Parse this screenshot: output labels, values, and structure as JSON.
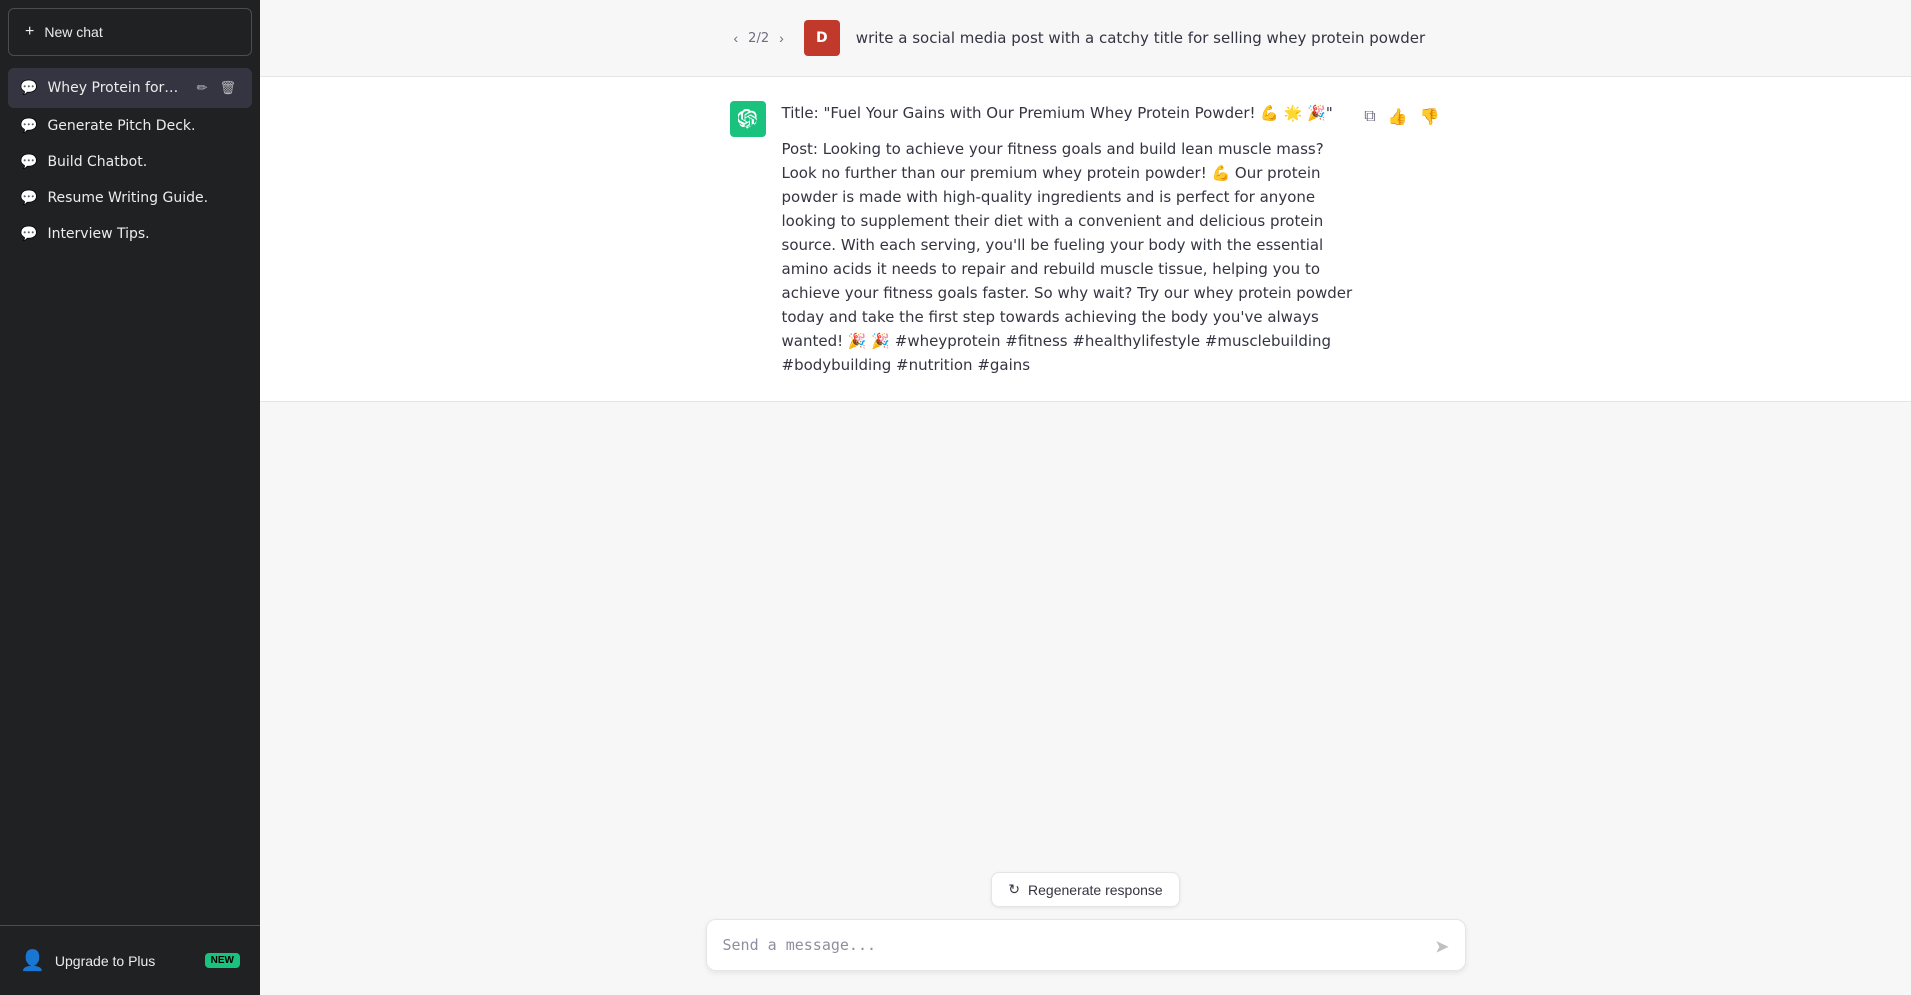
{
  "sidebar": {
    "new_chat_label": "New chat",
    "items": [
      {
        "id": "whey-protein",
        "label": "Whey Protein for Gains.",
        "active": true
      },
      {
        "id": "generate-pitch-deck",
        "label": "Generate Pitch Deck.",
        "active": false
      },
      {
        "id": "build-chatbot",
        "label": "Build Chatbot.",
        "active": false
      },
      {
        "id": "resume-writing-guide",
        "label": "Resume Writing Guide.",
        "active": false
      },
      {
        "id": "interview-tips",
        "label": "Interview Tips.",
        "active": false
      }
    ],
    "footer": {
      "upgrade_label": "Upgrade to Plus",
      "badge": "NEW"
    }
  },
  "chat": {
    "navigation": {
      "current": 2,
      "total": 2
    },
    "user_message": "write a social media post with a catchy title for selling whey protein powder",
    "user_avatar": "D",
    "ai_response_title": "Title: \"Fuel Your Gains with Our Premium Whey Protein Powder! 💪 🌟 🎉\"",
    "ai_response_body": "Post: Looking to achieve your fitness goals and build lean muscle mass? Look no further than our premium whey protein powder! 💪 Our protein powder is made with high-quality ingredients and is perfect for anyone looking to supplement their diet with a convenient and delicious protein source. With each serving, you'll be fueling your body with the essential amino acids it needs to repair and rebuild muscle tissue, helping you to achieve your fitness goals faster. So why wait? Try our whey protein powder today and take the first step towards achieving the body you've always wanted! 🎉 🎉 #wheyprotein #fitness #healthylifestyle #musclebuilding #bodybuilding #nutrition #gains"
  },
  "input": {
    "placeholder": "Send a message...",
    "regenerate_label": "Regenerate response"
  },
  "icons": {
    "plus": "+",
    "chat_bubble": "💬",
    "edit": "✏",
    "trash": "🗑",
    "user_circle": "👤",
    "chevron_left": "‹",
    "chevron_right": "›",
    "copy": "⧉",
    "thumbs_up": "👍",
    "thumbs_down": "👎",
    "send": "➤",
    "regenerate": "↻"
  }
}
